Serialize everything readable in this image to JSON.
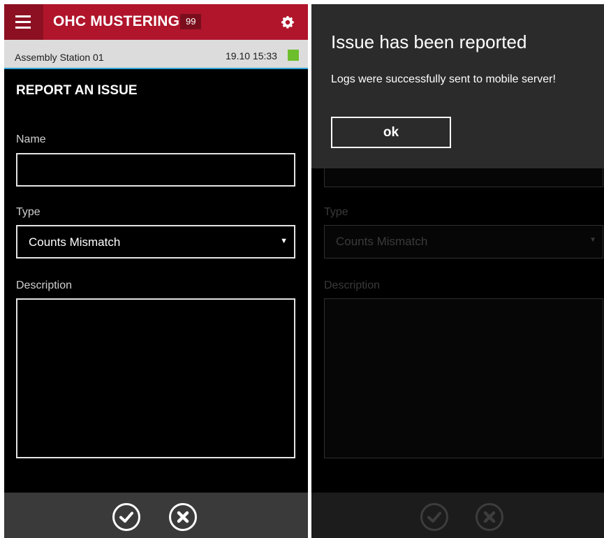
{
  "header": {
    "app_title": "OHC MUSTERING",
    "count_badge": "99",
    "menu_icon": "hamburger-menu-icon",
    "settings_icon": "gear-icon"
  },
  "subheader": {
    "station": "Assembly Station 01",
    "datetime": "19.10 15:33",
    "status_color": "#6dbe2c"
  },
  "form": {
    "title": "REPORT AN ISSUE",
    "name_label": "Name",
    "name_value": "",
    "type_label": "Type",
    "type_value": "Counts Mismatch",
    "description_label": "Description",
    "description_value": ""
  },
  "footer": {
    "confirm_icon": "check-circle-icon",
    "cancel_icon": "close-circle-icon"
  },
  "dialog": {
    "title": "Issue has been reported",
    "message": "Logs were successfully sent to mobile server!",
    "ok_label": "ok"
  },
  "colors": {
    "brand": "#b0152b",
    "accent_line": "#2ea3d8",
    "dialog_bg": "#2b2b2b"
  }
}
